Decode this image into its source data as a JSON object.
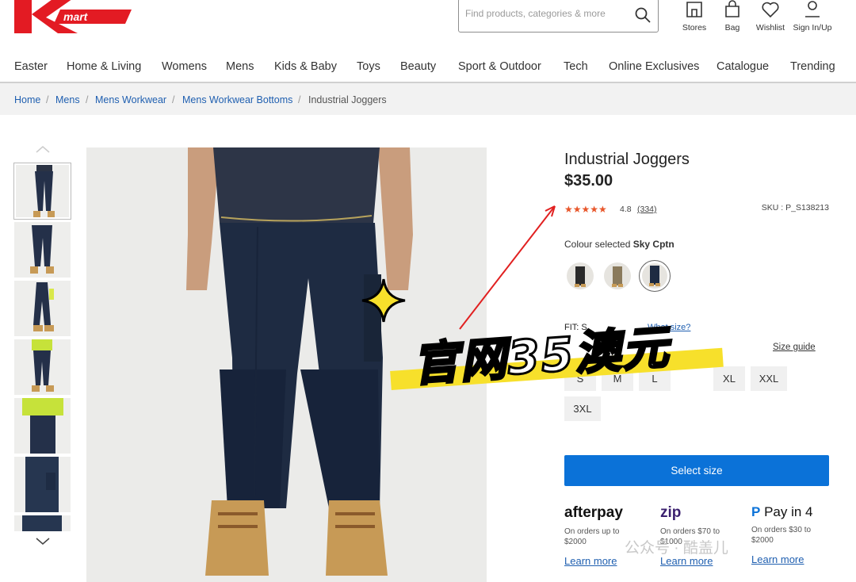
{
  "header": {
    "logo_text": "Kmart",
    "search_placeholder": "Find products, categories & more",
    "icons": [
      {
        "name": "stores",
        "label": "Stores"
      },
      {
        "name": "bag",
        "label": "Bag"
      },
      {
        "name": "wishlist",
        "label": "Wishlist"
      },
      {
        "name": "account",
        "label": "Sign In/Up"
      }
    ],
    "brand_color": "#e31b23"
  },
  "nav": {
    "items": [
      "Easter",
      "Home & Living",
      "Womens",
      "Mens",
      "Kids & Baby",
      "Toys",
      "Beauty",
      "Sport & Outdoor",
      "Tech",
      "Online Exclusives",
      "Catalogue",
      "Trending"
    ]
  },
  "breadcrumb": {
    "links": [
      "Home",
      "Mens",
      "Mens Workwear",
      "Mens Workwear Bottoms"
    ],
    "current": "Industrial Joggers",
    "separator": "/"
  },
  "product": {
    "title": "Industrial Joggers",
    "price": "$35.00",
    "stars": "★★★★★",
    "rating": "4.8",
    "reviews": "(334)",
    "sku": "SKU : P_S138213",
    "colour_label": "Colour selected",
    "colour_value": "Sky Cptn",
    "fit_label": "FIT: S",
    "what_size": "What size?",
    "size_guide": "Size guide",
    "sizes": [
      "S",
      "M",
      "L",
      "XL",
      "XXL",
      "3XL"
    ],
    "cta": "Select size"
  },
  "payments": [
    {
      "logo": "afterpay",
      "note": "On orders up to $2000",
      "link": "Learn more"
    },
    {
      "logo": "zip",
      "note": "On orders $70 to $1000",
      "link": "Learn more"
    },
    {
      "logo": "Pay in 4",
      "note": "On orders $30 to $2000",
      "link": "Learn more"
    }
  ],
  "overlay": {
    "text": "官网35澳元",
    "watermark": "公众号 · 酷盖儿",
    "accent": "#f7e02b"
  }
}
